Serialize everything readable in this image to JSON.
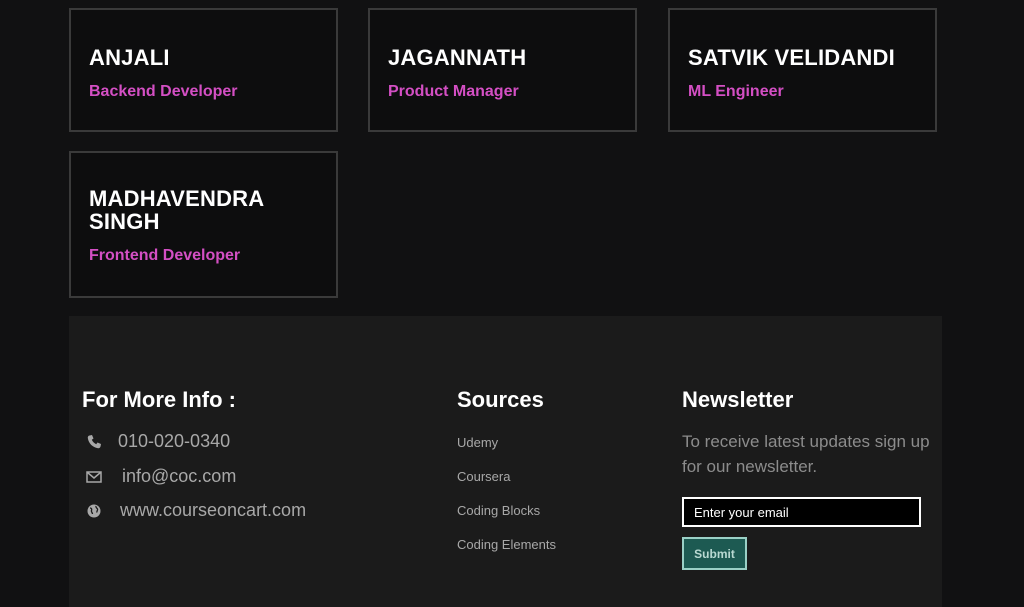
{
  "team": [
    {
      "name": "ANJALI",
      "role": "Backend Developer"
    },
    {
      "name": "JAGANNATH",
      "role": "Product Manager"
    },
    {
      "name": "SATVIK VELIDANDI",
      "role": "ML Engineer"
    },
    {
      "name": "MADHAVENDRA SINGH",
      "role": "Frontend Developer"
    }
  ],
  "footer": {
    "info": {
      "title": "For More Info :",
      "phone": "010-020-0340",
      "phone_icon": "phone-icon",
      "email": "info@coc.com",
      "email_icon": "envelope-icon",
      "website": "www.courseoncart.com",
      "website_icon": "globe-icon"
    },
    "sources": {
      "title": "Sources",
      "links": [
        "Udemy",
        "Coursera",
        "Coding Blocks",
        "Coding Elements"
      ]
    },
    "newsletter": {
      "title": "Newsletter",
      "text": "To receive latest updates sign up for our newsletter.",
      "placeholder": "Enter your email",
      "submit_label": "Submit"
    }
  },
  "colors": {
    "role_accent": "#d44fc4",
    "submit_bg": "#1d5a52"
  }
}
